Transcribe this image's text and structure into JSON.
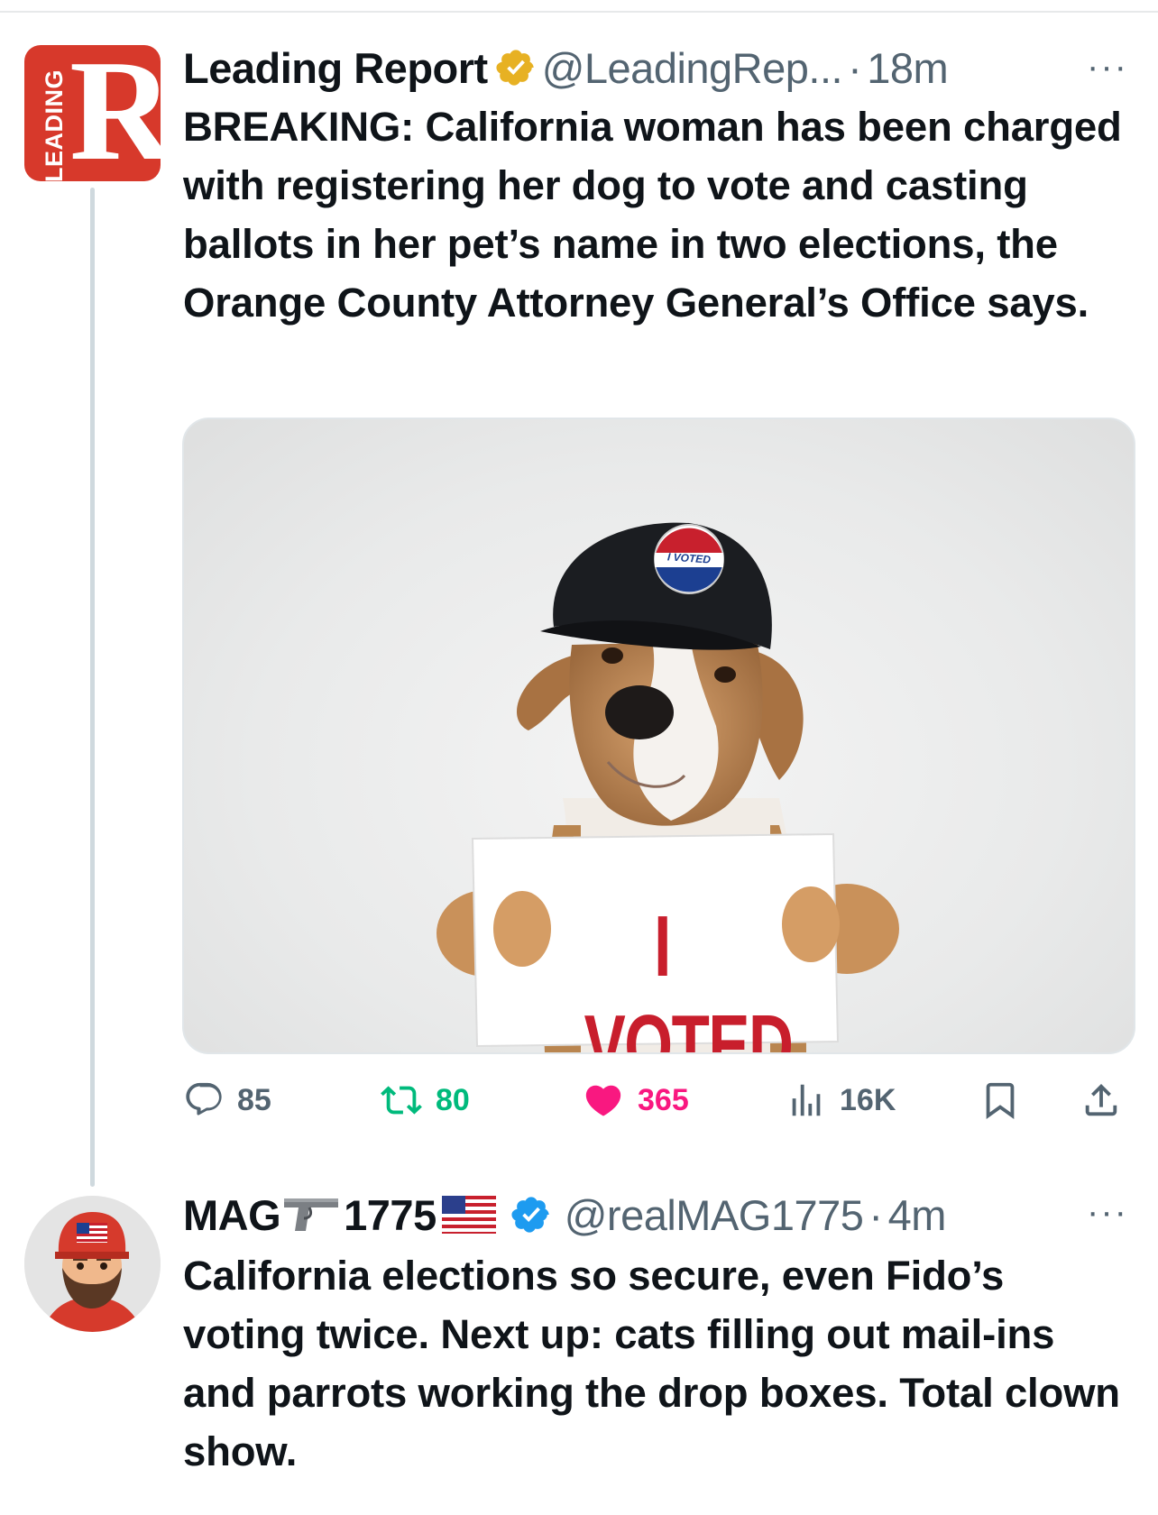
{
  "tweet1": {
    "avatar_letter": "R",
    "avatar_side_text": "LEADING",
    "name": "Leading Report",
    "handle": "@LeadingRep...",
    "separator": "·",
    "time": "18m",
    "more": "···",
    "text": "BREAKING: California woman has been charged with registering her dog to vote and casting ballots in her pet’s name in two elections, the Orange County Attorney General’s Office says.",
    "media": {
      "hat_badge_text": "I VOTED",
      "sign_text": "I VOTED"
    },
    "actions": {
      "replies": "85",
      "retweets": "80",
      "likes": "365",
      "views": "16K"
    },
    "colors": {
      "logo_red": "#d7392b",
      "gold_badge": "#e7b123"
    }
  },
  "tweet2": {
    "name": "MAG",
    "name_suffix": "1775",
    "handle": "@realMAG1775",
    "separator": "·",
    "time": "4m",
    "more": "···",
    "text": "California elections so secure, even Fido’s voting twice. Next up: cats filling out mail-ins and parrots working the drop boxes. Total clown show.",
    "colors": {
      "blue_badge": "#1d9bf0"
    }
  },
  "icons": [
    "reply-icon",
    "retweet-icon",
    "like-icon",
    "views-icon",
    "bookmark-icon",
    "share-icon",
    "verified-badge-icon",
    "us-flag-icon",
    "pistol-icon"
  ]
}
